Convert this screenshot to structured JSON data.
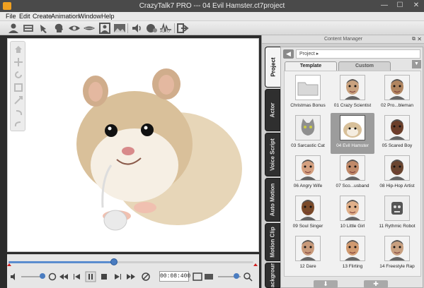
{
  "window": {
    "title": "CrazyTalk7 PRO --- 04 Evil Hamster.ct7project",
    "minimize": "—",
    "maximize": "☐",
    "close": "✕"
  },
  "menu": [
    "File",
    "Edit",
    "Create",
    "Animation",
    "Window",
    "Help"
  ],
  "toolbar": {
    "icons": [
      "actor-icon",
      "face-fitting-icon",
      "puppet-icon",
      "head-icon",
      "eye-icon",
      "mouth-icon",
      "face-frame-icon",
      "background-icon",
      "voice-icon",
      "face-puppet-icon",
      "auto-motion-icon",
      "export-icon"
    ],
    "auto_label": "AUTO"
  },
  "sidetools": [
    "home-icon",
    "move-icon",
    "rotate-icon",
    "scale-icon",
    "fit-icon",
    "undo-icon",
    "redo-icon"
  ],
  "playback": {
    "timecode": "00:08:400",
    "progress": 0.43
  },
  "content_manager": {
    "title": "Content Manager",
    "breadcrumb": "Project ▸",
    "vertical_tabs": [
      "Project",
      "Actor",
      "Voice Script",
      "Auto Motion",
      "Motion Clip",
      "Background"
    ],
    "subtabs": [
      "Template",
      "Custom"
    ],
    "items": [
      {
        "label": "Christmas Bonus",
        "kind": "folder"
      },
      {
        "label": "01 Crazy Scientist",
        "kind": "face",
        "color": "#c9a27f"
      },
      {
        "label": "02 Pro...bleman",
        "kind": "face",
        "color": "#b08560"
      },
      {
        "label": "03 Sarcastic Cat",
        "kind": "cat",
        "color": "#8f8f8f"
      },
      {
        "label": "04 Evil Hamster",
        "kind": "hamster",
        "color": "#d8c09a"
      },
      {
        "label": "05 Scared Boy",
        "kind": "face",
        "color": "#6b3f2a"
      },
      {
        "label": "06 Angry Wife",
        "kind": "face",
        "color": "#d4a080"
      },
      {
        "label": "07 Sco...usband",
        "kind": "face",
        "color": "#c08a6a"
      },
      {
        "label": "08 Hip-Hop Artist",
        "kind": "face",
        "color": "#6a4530"
      },
      {
        "label": "09 Soul Singer",
        "kind": "face",
        "color": "#7a4a2a"
      },
      {
        "label": "10 Little Girl",
        "kind": "face",
        "color": "#e0b08a"
      },
      {
        "label": "11 Rythmic Robot",
        "kind": "robot",
        "color": "#555555"
      },
      {
        "label": "12 Dare",
        "kind": "face",
        "color": "#c89a7a"
      },
      {
        "label": "13 Flirting",
        "kind": "face",
        "color": "#d09a70"
      },
      {
        "label": "14 Freestyle Rap",
        "kind": "face",
        "color": "#c8a080"
      }
    ],
    "bottom_buttons": [
      "⬇",
      "✚"
    ]
  }
}
